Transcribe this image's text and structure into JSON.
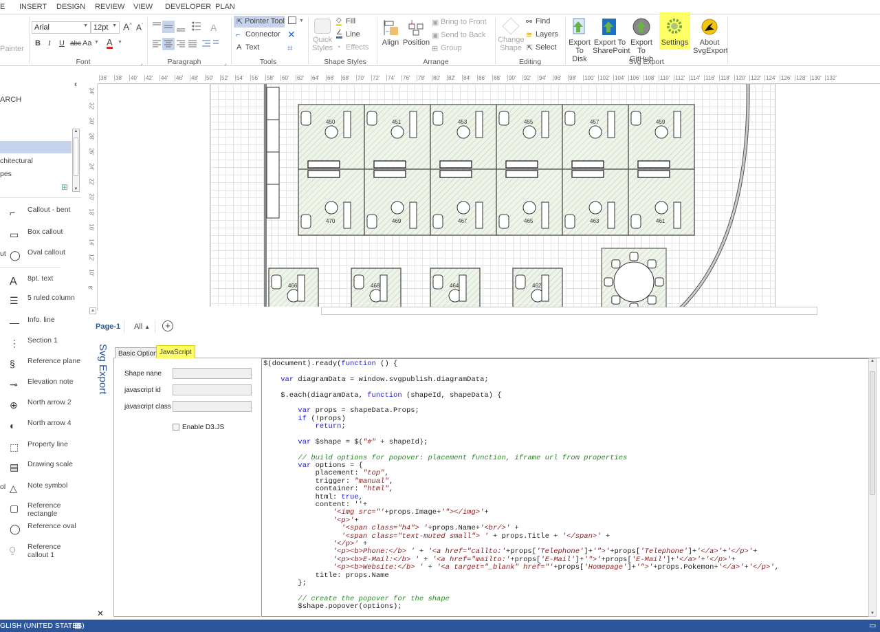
{
  "ribbon_tabs": [
    "E",
    "INSERT",
    "DESIGN",
    "REVIEW",
    "VIEW",
    "DEVELOPER",
    "PLAN"
  ],
  "ribbon": {
    "clipboard": {
      "format_painter": "Painter"
    },
    "font": {
      "label": "Font",
      "font_name": "Arial",
      "font_size": "12pt",
      "bold": "B",
      "italic": "I",
      "underline": "U",
      "strike": "abc",
      "case": "Aa",
      "font_color": "A"
    },
    "paragraph": {
      "label": "Paragraph"
    },
    "tools": {
      "label": "Tools",
      "pointer": "Pointer Tool",
      "connector": "Connector",
      "text": "Text"
    },
    "shape_styles": {
      "label": "Shape Styles",
      "quick_styles_1": "Quick",
      "quick_styles_2": "Styles",
      "fill": "Fill",
      "line": "Line",
      "effects": "Effects"
    },
    "arrange": {
      "label": "Arrange",
      "align": "Align",
      "position": "Position",
      "bring_to_front": "Bring to Front",
      "send_to_back": "Send to Back",
      "group": "Group"
    },
    "editing": {
      "label": "Editing",
      "change_shape_1": "Change",
      "change_shape_2": "Shape",
      "find": "Find",
      "layers": "Layers",
      "select": "Select"
    },
    "svg_export": {
      "label": "Svg Export",
      "export_disk_1": "Export",
      "export_disk_2": "To Disk",
      "export_sp_1": "Export To",
      "export_sp_2": "SharePoint",
      "export_gh_1": "Export To",
      "export_gh_2": "GitHub",
      "settings": "Settings",
      "about_1": "About",
      "about_2": "SvgExport"
    }
  },
  "shapes_panel": {
    "search_label": "ARCH",
    "categories": [
      "",
      "chitectural",
      "pes"
    ],
    "items": [
      {
        "label": "Callout - bent",
        "icon": "callout-bent-icon"
      },
      {
        "label": "Box callout",
        "icon": "box-callout-icon"
      },
      {
        "label": "Oval callout",
        "icon": "oval-callout-icon",
        "left_fragment": "ut"
      },
      {
        "label": "8pt. text",
        "icon": "text-a-icon"
      },
      {
        "label": "5 ruled column",
        "icon": "ruled-column-icon"
      },
      {
        "label": "Info. line",
        "icon": "info-line-icon"
      },
      {
        "label": "Section 1",
        "icon": "section-icon"
      },
      {
        "label": "Reference plane",
        "icon": "reference-plane-icon"
      },
      {
        "label": "Elevation note",
        "icon": "elevation-note-icon"
      },
      {
        "label": "North arrow 2",
        "icon": "north-arrow-icon"
      },
      {
        "label": "North arrow 4",
        "icon": "north-arrow-4-icon"
      },
      {
        "label": "Property line",
        "icon": "property-line-icon"
      },
      {
        "label": "Drawing scale",
        "icon": "drawing-scale-icon"
      },
      {
        "label": "Note symbol",
        "icon": "note-symbol-icon",
        "left_fragment": "ol"
      },
      {
        "label": "Reference rectangle",
        "icon": "reference-rectangle-icon"
      },
      {
        "label": "Reference oval",
        "icon": "reference-oval-icon"
      },
      {
        "label": "Reference callout 1",
        "icon": "reference-callout-icon"
      }
    ]
  },
  "rulers": {
    "horizontal": [
      "36'",
      "38'",
      "40'",
      "42'",
      "44'",
      "46'",
      "48'",
      "50'",
      "52'",
      "54'",
      "56'",
      "58'",
      "60'",
      "62'",
      "64'",
      "66'",
      "68'",
      "70'",
      "72'",
      "74'",
      "76'",
      "78'",
      "80'",
      "82'",
      "84'",
      "86'",
      "88'",
      "90'",
      "92'",
      "94'",
      "96'",
      "98'",
      "100'",
      "102'",
      "104'",
      "106'",
      "108'",
      "110'",
      "112'",
      "114'",
      "116'",
      "118'",
      "120'",
      "122'",
      "124'",
      "126'",
      "128'",
      "130'",
      "132'"
    ],
    "vertical": [
      "34'",
      "32'",
      "30'",
      "28'",
      "26'",
      "24'",
      "22'",
      "20'",
      "18'",
      "16'",
      "14'",
      "12'",
      "10'",
      "8'"
    ]
  },
  "diagram": {
    "top_row_offices": [
      "450",
      "451",
      "453",
      "455",
      "457",
      "459"
    ],
    "bottom_row_offices": [
      "470",
      "469",
      "467",
      "465",
      "463",
      "461"
    ],
    "lower_offices": [
      "466",
      "468",
      "464",
      "462"
    ]
  },
  "page_tabs": {
    "active": "Page-1",
    "all": "All",
    "add": "+"
  },
  "svg_export_panel": {
    "title": "Svg Export",
    "tabs": [
      "Basic Options",
      "JavaScript"
    ],
    "active_tab": "JavaScript",
    "fields": [
      {
        "label": "Shape nane",
        "value": ""
      },
      {
        "label": "javascript id",
        "value": ""
      },
      {
        "label": "javascript class",
        "value": ""
      }
    ],
    "enable_d3": {
      "label": "Enable D3.JS",
      "checked": false
    },
    "code_lines": [
      [
        [
          "t",
          "$(document).ready("
        ],
        [
          "k",
          "function"
        ],
        [
          "t",
          " () {"
        ]
      ],
      [],
      [
        [
          "t",
          "    "
        ],
        [
          "k",
          "var"
        ],
        [
          "t",
          " diagramData = window.svgpublish.diagramData;"
        ]
      ],
      [],
      [
        [
          "t",
          "    $.each(diagramData, "
        ],
        [
          "k",
          "function"
        ],
        [
          "t",
          " (shapeId, shapeData) {"
        ]
      ],
      [],
      [
        [
          "t",
          "        "
        ],
        [
          "k",
          "var"
        ],
        [
          "t",
          " props = shapeData.Props;"
        ]
      ],
      [
        [
          "t",
          "        "
        ],
        [
          "k",
          "if"
        ],
        [
          "t",
          " (!props)"
        ]
      ],
      [
        [
          "t",
          "            "
        ],
        [
          "k",
          "return"
        ],
        [
          "t",
          ";"
        ]
      ],
      [],
      [
        [
          "t",
          "        "
        ],
        [
          "k",
          "var"
        ],
        [
          "t",
          " $shape = $("
        ],
        [
          "s",
          "\"#\""
        ],
        [
          "t",
          " + shapeId);"
        ]
      ],
      [],
      [
        [
          "t",
          "        "
        ],
        [
          "c",
          "// build options for popover: placement function, iframe url from properties"
        ]
      ],
      [
        [
          "t",
          "        "
        ],
        [
          "k",
          "var"
        ],
        [
          "t",
          " options = {"
        ]
      ],
      [
        [
          "t",
          "            placement: "
        ],
        [
          "s",
          "\"top\""
        ],
        [
          "t",
          ","
        ]
      ],
      [
        [
          "t",
          "            trigger: "
        ],
        [
          "s",
          "\"manual\""
        ],
        [
          "t",
          ","
        ]
      ],
      [
        [
          "t",
          "            container: "
        ],
        [
          "s",
          "\"html\""
        ],
        [
          "t",
          ","
        ]
      ],
      [
        [
          "t",
          "            html: "
        ],
        [
          "k",
          "true"
        ],
        [
          "t",
          ","
        ]
      ],
      [
        [
          "t",
          "            content: ''+"
        ]
      ],
      [
        [
          "t",
          "                "
        ],
        [
          "s",
          "'<img src=\"'"
        ],
        [
          "t",
          "+props.Image+"
        ],
        [
          "s",
          "'\"></img>'"
        ],
        [
          "t",
          "+"
        ]
      ],
      [
        [
          "t",
          "                "
        ],
        [
          "s",
          "'<p>'"
        ],
        [
          "t",
          "+"
        ]
      ],
      [
        [
          "t",
          "                  "
        ],
        [
          "s",
          "'<span class=\"h4\"> '"
        ],
        [
          "t",
          "+props.Name+"
        ],
        [
          "s",
          "'<br/>'"
        ],
        [
          "t",
          " +"
        ]
      ],
      [
        [
          "t",
          "                  "
        ],
        [
          "s",
          "'<span class=\"text-muted small\"> '"
        ],
        [
          "t",
          " + props.Title + "
        ],
        [
          "s",
          "'</span>'"
        ],
        [
          "t",
          " +"
        ]
      ],
      [
        [
          "t",
          "                "
        ],
        [
          "s",
          "'</p>'"
        ],
        [
          "t",
          " +"
        ]
      ],
      [
        [
          "t",
          "                "
        ],
        [
          "s",
          "'<p><b>Phone:</b> '"
        ],
        [
          "t",
          " + "
        ],
        [
          "s",
          "'<a href=\"callto:'"
        ],
        [
          "t",
          "+props["
        ],
        [
          "s",
          "'Telephone'"
        ],
        [
          "t",
          "]+"
        ],
        [
          "s",
          "'\">'"
        ],
        [
          "t",
          "+props["
        ],
        [
          "s",
          "'Telephone'"
        ],
        [
          "t",
          "]+"
        ],
        [
          "s",
          "'</a>'"
        ],
        [
          "t",
          "+"
        ],
        [
          "s",
          "'</p>'"
        ],
        [
          "t",
          "+"
        ]
      ],
      [
        [
          "t",
          "                "
        ],
        [
          "s",
          "'<p><b>E-Mail:</b> '"
        ],
        [
          "t",
          " + "
        ],
        [
          "s",
          "'<a href=\"mailto:'"
        ],
        [
          "t",
          "+props["
        ],
        [
          "s",
          "'E-Mail'"
        ],
        [
          "t",
          "]+"
        ],
        [
          "s",
          "'\">'"
        ],
        [
          "t",
          "+props["
        ],
        [
          "s",
          "'E-Mail'"
        ],
        [
          "t",
          "]+"
        ],
        [
          "s",
          "'</a>'"
        ],
        [
          "t",
          "+"
        ],
        [
          "s",
          "'</p>'"
        ],
        [
          "t",
          "+"
        ]
      ],
      [
        [
          "t",
          "                "
        ],
        [
          "s",
          "'<p><b>Website:</b> '"
        ],
        [
          "t",
          " + "
        ],
        [
          "s",
          "'<a target=\"_blank\" href=\"'"
        ],
        [
          "t",
          "+props["
        ],
        [
          "s",
          "'Homepage'"
        ],
        [
          "t",
          "]+"
        ],
        [
          "s",
          "'\">'"
        ],
        [
          "t",
          "+props.Pokemon+"
        ],
        [
          "s",
          "'</a>'"
        ],
        [
          "t",
          "+"
        ],
        [
          "s",
          "'</p>'"
        ],
        [
          "t",
          ","
        ]
      ],
      [
        [
          "t",
          "            title: props.Name"
        ]
      ],
      [
        [
          "t",
          "        };"
        ]
      ],
      [],
      [
        [
          "t",
          "        "
        ],
        [
          "c",
          "// create the popover for the shape"
        ]
      ],
      [
        [
          "t",
          "        $shape.popover(options);"
        ]
      ]
    ]
  },
  "status_bar": {
    "language": "GLISH (UNITED STATES)"
  },
  "colors": {
    "accent": "#2b579a",
    "highlight": "#ffff66",
    "selection": "#c5d3ec",
    "hatch": "#e6efe3"
  }
}
